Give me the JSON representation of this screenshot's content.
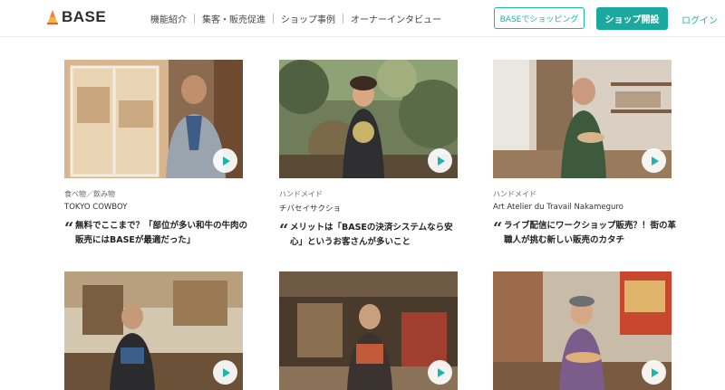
{
  "header": {
    "logo_text": "BASE",
    "nav": [
      "機能紹介",
      "集客・販売促進",
      "ショップ事例",
      "オーナーインタビュー"
    ],
    "shop_button": "BASEでショッピング",
    "open_shop_button": "ショップ開設",
    "login": "ログイン"
  },
  "colors": {
    "accent": "#1aa89f",
    "accent_light": "#1cb5ac"
  },
  "cards": [
    {
      "category": "食べ物／飲み物",
      "shop": "TOKYO COWBOY",
      "quote_lines": [
        "無料でここまで？「部位が多い和牛の牛肉の",
        "販売にはBASEが最適だった」"
      ]
    },
    {
      "category": "ハンドメイド",
      "shop": "チバセイサクショ",
      "quote_lines": [
        "メリットは「BASEの決済システムなら安",
        "心」というお客さんが多いこと"
      ]
    },
    {
      "category": "ハンドメイド",
      "shop": "Art Atelier du Travail Nakameguro",
      "quote_lines": [
        "ライブ配信にワークショップ販売？！街の革",
        "職人が挑む新しい販売のカタチ"
      ]
    },
    {
      "category": "",
      "shop": "",
      "quote_lines": []
    },
    {
      "category": "",
      "shop": "",
      "quote_lines": []
    },
    {
      "category": "",
      "shop": "",
      "quote_lines": []
    }
  ]
}
